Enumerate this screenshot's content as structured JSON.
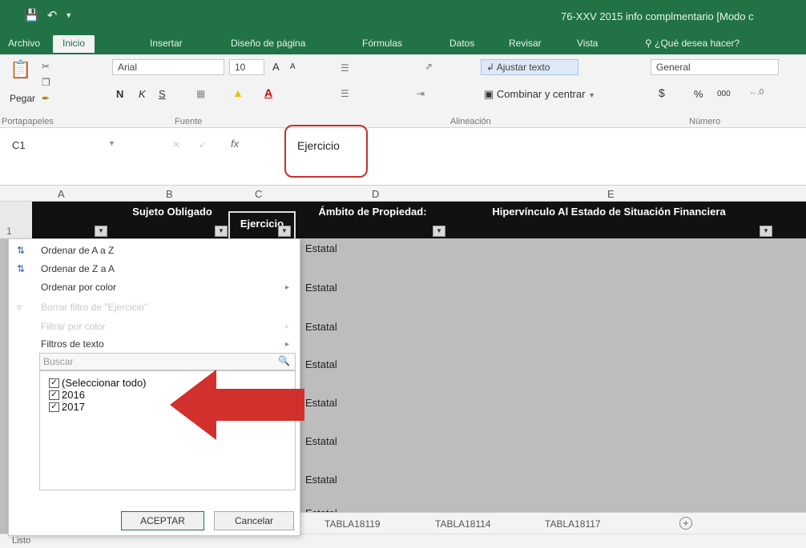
{
  "window": {
    "document_title": "76-XXV 2015 info complmentario  [Modo c"
  },
  "ribbon_tabs": [
    "Archivo",
    "Inicio",
    "Insertar",
    "Diseño de página",
    "Fórmulas",
    "Datos",
    "Revisar",
    "Vista",
    "¿Qué desea hacer?"
  ],
  "ribbon": {
    "paste_label": "Pegar",
    "font_name": "Arial",
    "font_size": "10",
    "bold": "N",
    "italic": "K",
    "underline": "S",
    "grow_font": "A",
    "shrink_font": "A",
    "wrap_text": "Ajustar texto",
    "merge_center": "Combinar y centrar",
    "number_format": "General",
    "currency": "$",
    "percent": "%",
    "thousands": "000",
    "group_labels": [
      "Portapapeles",
      "Fuente",
      "Alineación",
      "Número"
    ]
  },
  "formula_bar": {
    "name_box": "C1",
    "fx": "fx",
    "value": "Ejercicio"
  },
  "columns": [
    "A",
    "B",
    "C",
    "D",
    "E"
  ],
  "header_row": {
    "row_number": "1",
    "cells": [
      "Sujeto Obligado",
      "Ejercicio",
      "Ámbito de Propiedad:",
      "Hipervínculo Al Estado de Situación Financiera"
    ]
  },
  "rows": [
    "Estatal",
    "Estatal",
    "Estatal",
    "Estatal",
    "Estatal",
    "Estatal",
    "Estatal",
    "Estatal"
  ],
  "filter_menu": {
    "sort_asc": "Ordenar de A a Z",
    "sort_desc": "Ordenar de Z a A",
    "sort_color": "Ordenar por color",
    "clear_filter": "Borrar filtro de \"Ejercicio\"",
    "filter_color": "Filtrar por color",
    "text_filters": "Filtros de texto",
    "search_placeholder": "Buscar",
    "options": [
      {
        "label": "(Seleccionar todo)",
        "checked": true
      },
      {
        "label": "2016",
        "checked": true
      },
      {
        "label": "2017",
        "checked": true
      }
    ],
    "ok_label": "ACEPTAR",
    "cancel_label": "Cancelar"
  },
  "sheet_tabs": [
    "TABLA18119",
    "TABLA18114",
    "TABLA18117"
  ],
  "add_sheet": "+",
  "status": {
    "text": "Listo"
  },
  "colors": {
    "excel_green": "#217346",
    "arrow_red": "#d2302c",
    "highlight_red": "#c9302c"
  }
}
